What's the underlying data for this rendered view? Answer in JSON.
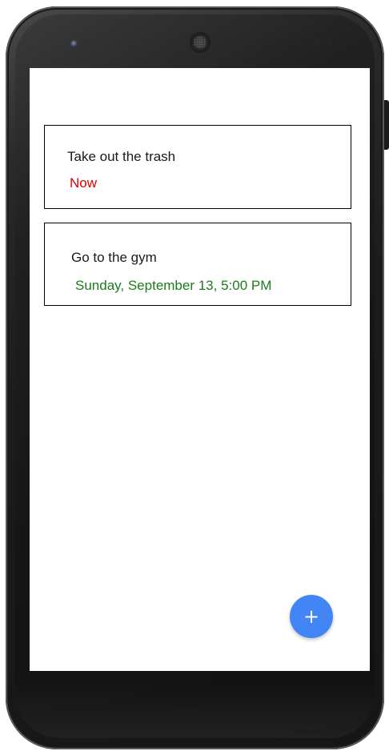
{
  "tasks": [
    {
      "title": "Take out the trash",
      "time": "Now",
      "time_color": "#e00000"
    },
    {
      "title": "Go to the gym",
      "time": "Sunday, September 13, 5:00 PM",
      "time_color": "#1a7d1a"
    }
  ],
  "fab": {
    "icon": "plus-icon",
    "glyph": "+",
    "color": "#4285f4"
  },
  "device": {
    "frame": "android-phone-frame"
  }
}
